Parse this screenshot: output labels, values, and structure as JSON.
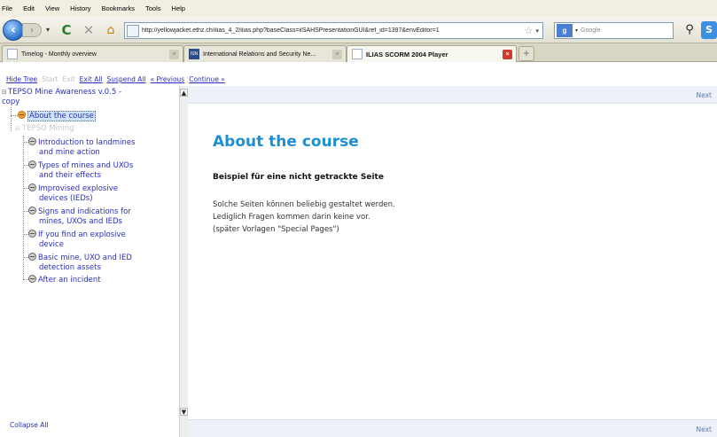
{
  "menu": [
    "File",
    "Edit",
    "View",
    "History",
    "Bookmarks",
    "Tools",
    "Help"
  ],
  "nav": {
    "url": "http://yellowjacket.ethz.ch/ilias_4_2/ilias.php?baseClass=ilSAHSPresentationGUI&ref_id=1397&envEditor=1",
    "search_placeholder": "Google"
  },
  "tabs": [
    {
      "title": "Timelog - Monthly overview"
    },
    {
      "title": "International Relations and Security Ne..."
    },
    {
      "title": "ILIAS SCORM 2004 Player"
    }
  ],
  "commands": {
    "hide_tree": "Hide Tree",
    "start": "Start",
    "exit": "Exit",
    "exit_all": "Exit All",
    "suspend_all": "Suspend All",
    "previous": "« Previous",
    "continue": "Continue »"
  },
  "tree": {
    "root_line1": "TEPSO Mine Awareness v.0.5 -",
    "root_line2": "copy",
    "about": "About the course",
    "mining": "TEPSO Mining",
    "items": [
      [
        "Introduction to landmines",
        "and mine action"
      ],
      [
        "Types of mines and UXOs",
        "and their effects"
      ],
      [
        "Improvised explosive",
        "devices (IEDs)"
      ],
      [
        "Signs and indications for",
        "mines, UXOs and IEDs"
      ],
      [
        "If you find an explosive",
        "device"
      ],
      [
        "Basic mine, UXO and IED",
        "detection assets"
      ],
      [
        "After an incident"
      ]
    ],
    "collapse_all": "Collapse All"
  },
  "content": {
    "next_top": "Next",
    "next_bottom": "Next",
    "title": "About the course",
    "subtitle": "Beispiel für eine nicht getrackte Seite",
    "body_lines": [
      "Solche Seiten können beliebig gestaltet werden.",
      "Lediglich Fragen kommen darin keine vor.",
      "(später Vorlagen \"Special Pages\")"
    ]
  }
}
